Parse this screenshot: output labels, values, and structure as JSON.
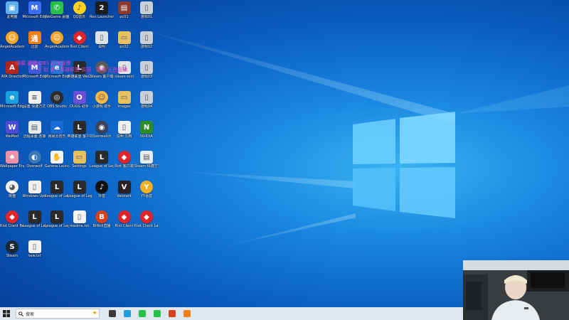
{
  "desktop": {
    "icons": [
      {
        "label": "此电脑",
        "color": "#5fb0f0",
        "g": "▣"
      },
      {
        "label": "Microsoft Edge浏览器",
        "color": "#3b6ef5",
        "g": "M"
      },
      {
        "label": "WeGame 桌面端",
        "color": "#27c14c",
        "g": "✆"
      },
      {
        "label": "QQ音乐",
        "color": "#ffd21f",
        "g": "♪"
      },
      {
        "label": "Ren Launcher",
        "color": "#1d1d1d",
        "g": "2"
      },
      {
        "label": "pc01",
        "color": "#8b3a2c",
        "g": "▤"
      },
      {
        "label": "游戏01",
        "color": "#c9cfd6",
        "g": "▯"
      },
      {
        "label": "AngelAcademy 下载器",
        "color": "#f0a52c",
        "g": "☺"
      },
      {
        "label": "迅雷",
        "color": "#f07f16",
        "g": "通"
      },
      {
        "label": "AngelAcademy",
        "color": "#f0a52c",
        "g": "☺"
      },
      {
        "label": "Riot Client",
        "color": "#e0242b",
        "g": "◆"
      },
      {
        "label": "说明",
        "color": "#dde2e7",
        "g": "▯"
      },
      {
        "label": "pc02",
        "color": "#e8c062",
        "g": "▭"
      },
      {
        "label": "游戏02",
        "color": "#c9cfd6",
        "g": "▯"
      },
      {
        "label": "AYA Director",
        "color": "#b0271f",
        "g": "A"
      },
      {
        "label": "Microsoft Edge",
        "color": "#4059d8",
        "g": "M"
      },
      {
        "label": "Microsoft Edge",
        "color": "#2874d6",
        "g": "e"
      },
      {
        "label": "英雄联盟 WeGame版",
        "color": "#2a2a2a",
        "g": "L"
      },
      {
        "label": "Steam 客户端",
        "color": "#5a5a5a",
        "g": "◉"
      },
      {
        "label": "steam-tool",
        "color": "#dfe3e8",
        "g": "▯"
      },
      {
        "label": "游戏03",
        "color": "#c9cfd6",
        "g": "▯"
      },
      {
        "label": "Microsoft Edge",
        "color": "#1aa0e0",
        "g": "e"
      },
      {
        "label": "设置 快捷方式",
        "color": "#f1f1f1",
        "g": "≡"
      },
      {
        "label": "OBS Studio",
        "color": "#2a2a2a",
        "g": "◎"
      },
      {
        "label": "OUGG 助手",
        "color": "#6b4fd8",
        "g": "O"
      },
      {
        "label": "小游戏 助手",
        "color": "#f6b84a",
        "g": "☺"
      },
      {
        "label": "Images",
        "color": "#e8c062",
        "g": "▭"
      },
      {
        "label": "游戏04",
        "color": "#c9cfd6",
        "g": "▯"
      },
      {
        "label": "WeMod",
        "color": "#4d4ad8",
        "g": "W"
      },
      {
        "label": "远程桌面 连接",
        "color": "#e7ecf1",
        "g": "▤"
      },
      {
        "label": "网易云音乐",
        "color": "#1a6bd8",
        "g": "☁"
      },
      {
        "label": "英雄联盟 客户端",
        "color": "#2a2a2a",
        "g": "L"
      },
      {
        "label": "Overwatch",
        "color": "#3d4358",
        "g": "◉"
      },
      {
        "label": "说明 文档",
        "color": "#eef0f2",
        "g": "▯"
      },
      {
        "label": "NVIDIA",
        "color": "#2d8b2a",
        "g": "N"
      },
      {
        "label": "Wallpaper Engine",
        "color": "#e992a8",
        "g": "♠"
      },
      {
        "label": "Overwolf",
        "color": "#3a78b8",
        "g": "◐"
      },
      {
        "label": "Garena Launcher",
        "color": "#f2f2f2",
        "g": "✋"
      },
      {
        "label": "Settings",
        "color": "#e8c062",
        "g": "▭"
      },
      {
        "label": "League of Legends",
        "color": "#2a2a2a",
        "g": "L"
      },
      {
        "label": "Riot 客户端",
        "color": "#e0242b",
        "g": "◆"
      },
      {
        "label": "Steam 快捷方式",
        "color": "#e7ecf1",
        "g": "▤"
      },
      {
        "label": "熊猫",
        "color": "#f2f2f2",
        "g": "◕"
      },
      {
        "label": "Windows Update助手",
        "color": "#eef0f2",
        "g": "▯"
      },
      {
        "label": "League of Legends",
        "color": "#2a2a2a",
        "g": "L"
      },
      {
        "label": "League of Legends PBE",
        "color": "#2a2a2a",
        "g": "L"
      },
      {
        "label": "抖音",
        "color": "#111",
        "g": "♪"
      },
      {
        "label": "Valorant",
        "color": "#2a1f22",
        "g": "V"
      },
      {
        "label": "YY语音",
        "color": "#f0b020",
        "g": "Y"
      },
      {
        "label": "Riot Client Beta",
        "color": "#e0242b",
        "g": "◆"
      },
      {
        "label": "League of Legends (TW)",
        "color": "#2a2a2a",
        "g": "L"
      },
      {
        "label": "League of Legends (KR)",
        "color": "#2a2a2a",
        "g": "L"
      },
      {
        "label": "readme.txt",
        "color": "#f2f2f2",
        "g": "▯"
      },
      {
        "label": "Bilibili直播",
        "color": "#d8401a",
        "g": "B"
      },
      {
        "label": "Riot Client",
        "color": "#e0242b",
        "g": "◆"
      },
      {
        "label": "Riot Client Launcher",
        "color": "#e0242b",
        "g": "◆"
      },
      {
        "label": "Steam",
        "color": "#1b2838",
        "g": "S"
      },
      {
        "label": "new.txt",
        "color": "#f2f2f2",
        "g": "▯"
      }
    ]
  },
  "overlay": {
    "line1": "弹幕 直播 OBS 正在直播",
    "line2": "一 起 看 · 英雄联盟 实况 · 游戏 正在直播"
  },
  "taskbar": {
    "search_placeholder": "搜索",
    "search_icon": "search-icon",
    "start_icon": "windows-logo-icon",
    "pinned": [
      {
        "name": "task-view-icon",
        "color": "#3a3a3a"
      },
      {
        "name": "edge-icon",
        "color": "#1aa0e0"
      },
      {
        "name": "wechat-icon",
        "color": "#27c14c"
      },
      {
        "name": "wechat-active-icon",
        "color": "#27c14c"
      },
      {
        "name": "red-app-icon",
        "color": "#d8401a"
      },
      {
        "name": "orange-app-icon",
        "color": "#f07f16"
      }
    ]
  }
}
